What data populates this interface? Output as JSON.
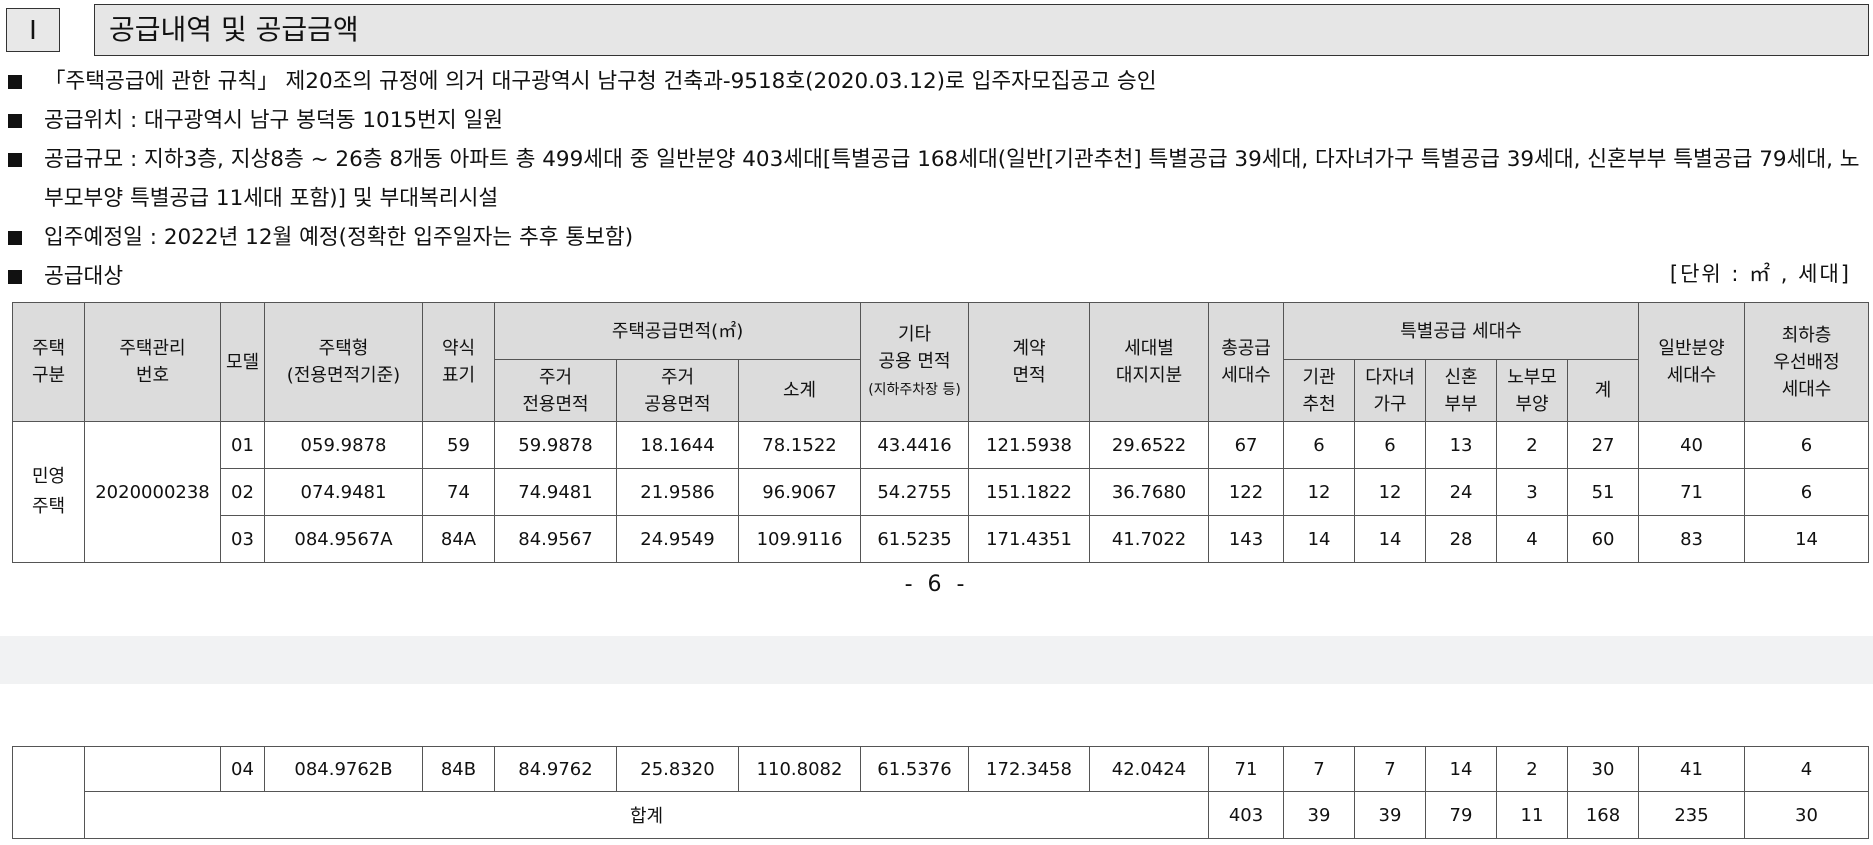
{
  "section": {
    "number": "I",
    "title": "공급내역 및 공급금액"
  },
  "bullets": [
    "「주택공급에 관한 규칙」 제20조의 규정에 의거 대구광역시 남구청 건축과-9518호(2020.03.12)로 입주자모집공고 승인",
    "공급위치 : 대구광역시 남구 봉덕동 1015번지 일원",
    "공급규모 : 지하3층, 지상8층 ~ 26층 8개동 아파트 총 499세대 중 일반분양 403세대[특별공급 168세대(일반[기관추천] 특별공급 39세대, 다자녀가구 특별공급 39세대, 신혼부부 특별공급 79세대, 노부모부양 특별공급 11세대 포함)] 및 부대복리시설",
    "입주예정일 : 2022년 12월 예정(정확한 입주일자는 추후 통보함)",
    "공급대상"
  ],
  "unit_note": "[단위 : ㎡ , 세대]",
  "table": {
    "headers": {
      "house_type": "주택\n구분",
      "mgmt_no": "주택관리\n번호",
      "model": "모델",
      "house_form": "주택형\n(전용면적기준)",
      "short": "약식\n표기",
      "supply_area": "주택공급면적(㎡)",
      "excl_area": "주거\n전용면적",
      "common_area": "주거\n공용면적",
      "subtotal": "소계",
      "other_common": "기타\n공용 면적",
      "other_common_note": "(지하주차장 등)",
      "contract_area": "계약\n면적",
      "land_share": "세대별\n대지지분",
      "total_supply": "총공급\n세대수",
      "special": "특별공급 세대수",
      "sp_inst": "기관\n추천",
      "sp_multi": "다자녀\n가구",
      "sp_newly": "신혼\n부부",
      "sp_elder": "노부모\n부양",
      "sp_sum": "계",
      "general": "일반분양\n세대수",
      "lowest": "최하층\n우선배정\n세대수"
    },
    "group_label": "민영\n주택",
    "mgmt_number": "2020000238",
    "rows": [
      [
        "01",
        "059.9878",
        "59",
        "59.9878",
        "18.1644",
        "78.1522",
        "43.4416",
        "121.5938",
        "29.6522",
        "67",
        "6",
        "6",
        "13",
        "2",
        "27",
        "40",
        "6"
      ],
      [
        "02",
        "074.9481",
        "74",
        "74.9481",
        "21.9586",
        "96.9067",
        "54.2755",
        "151.1822",
        "36.7680",
        "122",
        "12",
        "12",
        "24",
        "3",
        "51",
        "71",
        "6"
      ],
      [
        "03",
        "084.9567A",
        "84A",
        "84.9567",
        "24.9549",
        "109.9116",
        "61.5235",
        "171.4351",
        "41.7022",
        "143",
        "14",
        "14",
        "28",
        "4",
        "60",
        "83",
        "14"
      ]
    ],
    "continued_row": [
      "04",
      "084.9762B",
      "84B",
      "84.9762",
      "25.8320",
      "110.8082",
      "61.5376",
      "172.3458",
      "42.0424",
      "71",
      "7",
      "7",
      "14",
      "2",
      "30",
      "41",
      "4"
    ],
    "total_label": "합계",
    "total_values": [
      "403",
      "39",
      "39",
      "79",
      "11",
      "168",
      "235",
      "30"
    ]
  },
  "page_number": "- 6 -"
}
